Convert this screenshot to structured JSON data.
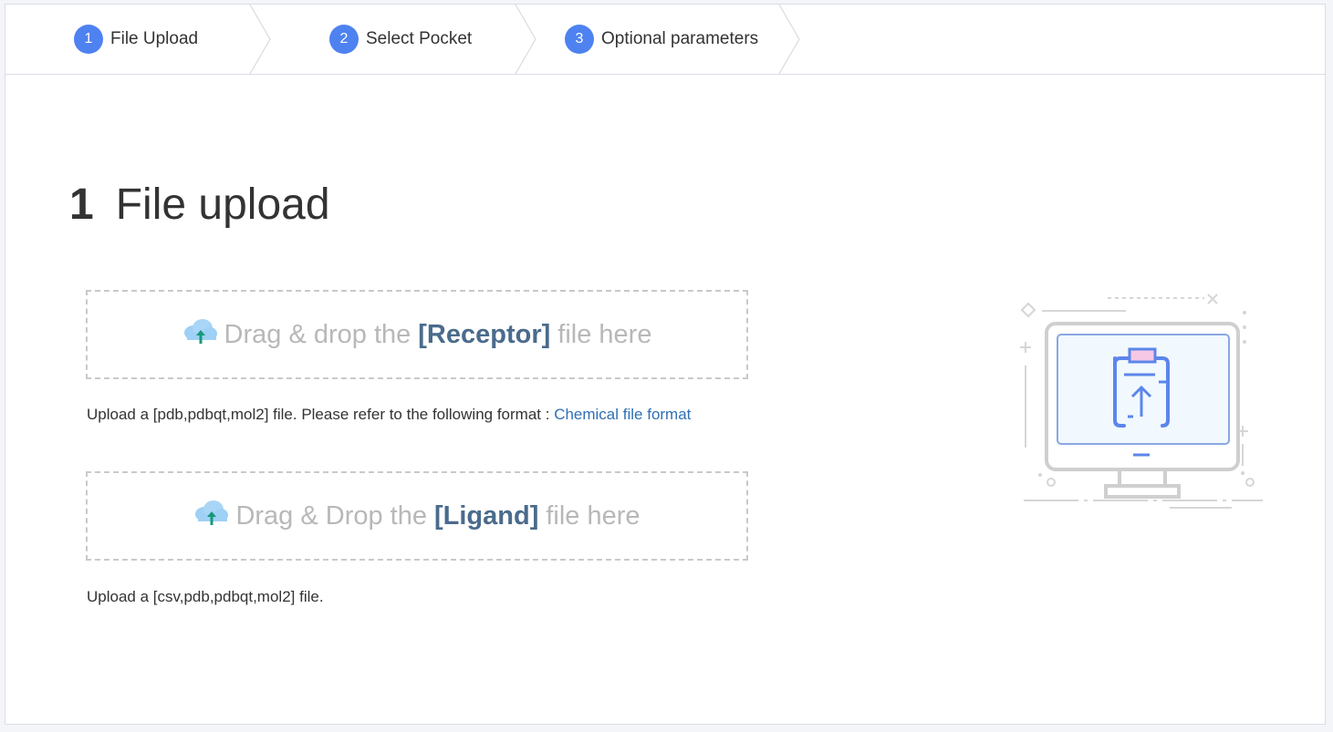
{
  "steps": [
    {
      "num": "1",
      "label": "File Upload"
    },
    {
      "num": "2",
      "label": "Select Pocket"
    },
    {
      "num": "3",
      "label": "Optional parameters"
    }
  ],
  "page": {
    "title_num": "1",
    "title": "File upload"
  },
  "receptor": {
    "prefix": "Drag & drop the",
    "keyword": "[Receptor]",
    "suffix": "file here",
    "hint": "Upload a [pdb,pdbqt,mol2] file. Please refer to the following format :",
    "link": "Chemical file format"
  },
  "ligand": {
    "prefix": "Drag & Drop the",
    "keyword": "[Ligand]",
    "suffix": "file here",
    "hint": "Upload a [csv,pdb,pdbqt,mol2] file."
  },
  "colors": {
    "accent": "#4e82f1",
    "keyword": "#4a6b8c",
    "link": "#2f6fb5"
  },
  "icons": [
    "cloud-upload-icon",
    "computer-upload-illustration"
  ]
}
